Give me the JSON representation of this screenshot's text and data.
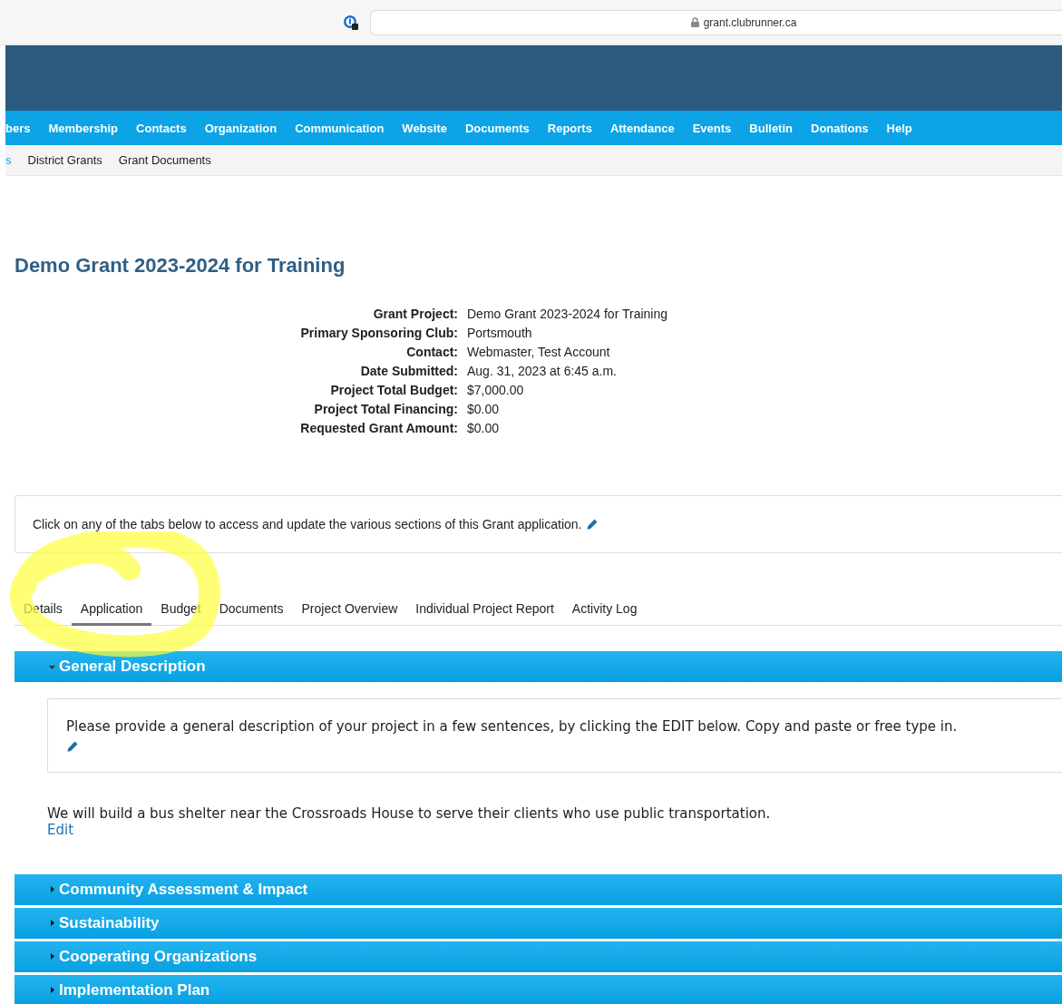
{
  "browser": {
    "url": "grant.clubrunner.ca"
  },
  "nav": {
    "items": [
      {
        "label": "bers",
        "selected": false
      },
      {
        "label": "Membership",
        "selected": false
      },
      {
        "label": "Contacts",
        "selected": false
      },
      {
        "label": "Organization",
        "selected": false
      },
      {
        "label": "Communication",
        "selected": false
      },
      {
        "label": "Website",
        "selected": false
      },
      {
        "label": "Documents",
        "selected": false
      },
      {
        "label": "Reports",
        "selected": false
      },
      {
        "label": "Attendance",
        "selected": false
      },
      {
        "label": "Events",
        "selected": false
      },
      {
        "label": "Bulletin",
        "selected": false
      },
      {
        "label": "Donations",
        "selected": false
      },
      {
        "label": "Help",
        "selected": false
      }
    ]
  },
  "subnav": {
    "items": [
      "s",
      "District Grants",
      "Grant Documents"
    ]
  },
  "page_title": "Demo Grant 2023-2024 for Training",
  "details": [
    {
      "label": "Grant Project:",
      "value": "Demo Grant 2023-2024 for Training"
    },
    {
      "label": "Primary Sponsoring Club:",
      "value": "Portsmouth"
    },
    {
      "label": "Contact:",
      "value": "Webmaster, Test Account"
    },
    {
      "label": "Date Submitted:",
      "value": "Aug. 31, 2023 at 6:45 a.m."
    },
    {
      "label": "Project Total Budget:",
      "value": "$7,000.00"
    },
    {
      "label": "Project Total Financing:",
      "value": "$0.00"
    },
    {
      "label": "Requested Grant Amount:",
      "value": "$0.00"
    }
  ],
  "info_note": "Click on any of the tabs below to access and update the various sections of this Grant application.",
  "tabs": [
    {
      "label": "Details",
      "selected": false
    },
    {
      "label": "Application",
      "selected": true
    },
    {
      "label": "Budget",
      "selected": false
    },
    {
      "label": "Documents",
      "selected": false
    },
    {
      "label": "Project Overview",
      "selected": false
    },
    {
      "label": "Individual Project Report",
      "selected": false
    },
    {
      "label": "Activity Log",
      "selected": false
    }
  ],
  "sections": [
    {
      "title": "General Description",
      "expanded": true,
      "prompt": "Please provide a general description of your project in a few sentences, by clicking the EDIT below. Copy and paste or free type in.",
      "answer": "We will build a bus shelter near the Crossroads House to serve their clients who use public transportation.",
      "edit_label": "Edit"
    },
    {
      "title": "Community Assessment & Impact",
      "expanded": false
    },
    {
      "title": "Sustainability",
      "expanded": false
    },
    {
      "title": "Cooperating Organizations",
      "expanded": false
    },
    {
      "title": "Implementation Plan",
      "expanded": false
    }
  ]
}
